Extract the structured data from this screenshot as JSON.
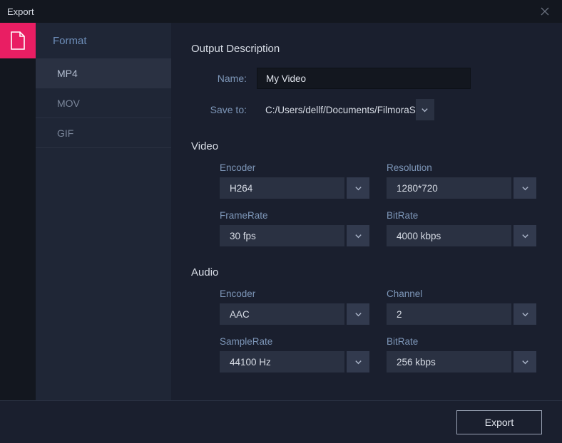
{
  "window": {
    "title": "Export"
  },
  "sidebar": {
    "header": "Format",
    "items": [
      "MP4",
      "MOV",
      "GIF"
    ],
    "activeIndex": 0
  },
  "output": {
    "section": "Output Description",
    "nameLabel": "Name:",
    "nameValue": "My Video",
    "saveLabel": "Save to:",
    "savePath": "C:/Users/dellf/Documents/FilmoraS"
  },
  "video": {
    "title": "Video",
    "encoder": {
      "label": "Encoder",
      "value": "H264"
    },
    "resolution": {
      "label": "Resolution",
      "value": "1280*720"
    },
    "framerate": {
      "label": "FrameRate",
      "value": "30 fps"
    },
    "bitrate": {
      "label": "BitRate",
      "value": "4000 kbps"
    }
  },
  "audio": {
    "title": "Audio",
    "encoder": {
      "label": "Encoder",
      "value": "AAC"
    },
    "channel": {
      "label": "Channel",
      "value": "2"
    },
    "samplerate": {
      "label": "SampleRate",
      "value": "44100 Hz"
    },
    "bitrate": {
      "label": "BitRate",
      "value": "256 kbps"
    }
  },
  "footer": {
    "export": "Export"
  }
}
